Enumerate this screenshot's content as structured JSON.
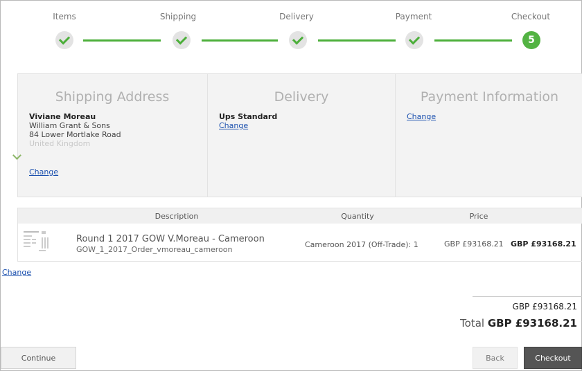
{
  "stepper": {
    "steps": [
      {
        "label": "Items",
        "state": "done"
      },
      {
        "label": "Shipping",
        "state": "done"
      },
      {
        "label": "Delivery",
        "state": "done"
      },
      {
        "label": "Payment",
        "state": "done"
      },
      {
        "label": "Checkout",
        "state": "current",
        "number": "5"
      }
    ],
    "accent": "#53b343"
  },
  "summary": {
    "shipping": {
      "title": "Shipping Address",
      "name": "Viviane Moreau",
      "company": "William Grant & Sons",
      "street": "84 Lower Mortlake Road",
      "country": "United Kingdom",
      "change": "Change"
    },
    "delivery": {
      "title": "Delivery",
      "method": "Ups Standard",
      "change": "Change"
    },
    "payment": {
      "title": "Payment Information",
      "change": "Change"
    }
  },
  "table": {
    "headers": {
      "description": "Description",
      "quantity": "Quantity",
      "price": "Price"
    },
    "rows": [
      {
        "title": "Round 1 2017 GOW V.Moreau - Cameroon",
        "subtitle": "GOW_1_2017_Order_vmoreau_cameroon",
        "quantity": "Cameroon 2017 (Off-Trade): 1",
        "price": "GBP £93168.21",
        "total": "GBP £93168.21"
      }
    ],
    "change": "Change"
  },
  "totals": {
    "subtotal": "GBP £93168.21",
    "total_label": "Total",
    "total": "GBP £93168.21"
  },
  "buttons": {
    "continue": "Continue",
    "back": "Back",
    "checkout": "Checkout"
  }
}
